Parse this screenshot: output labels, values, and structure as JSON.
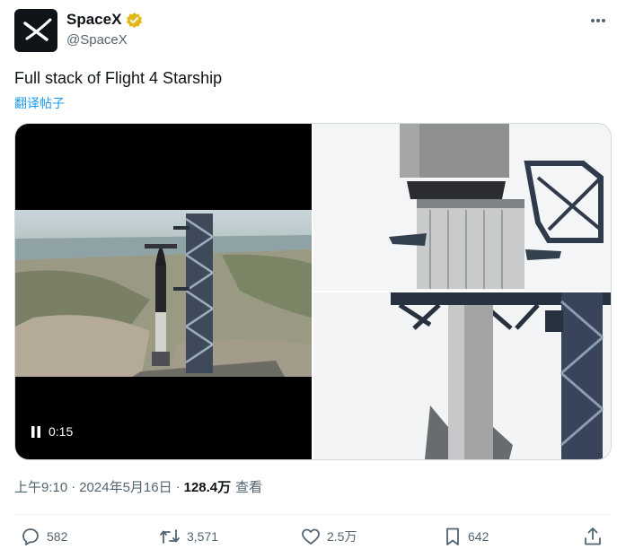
{
  "account": {
    "display_name": "SpaceX",
    "handle": "@SpaceX",
    "avatar_icon": "spacex-x-logo-icon",
    "verified_icon": "verified-badge-icon",
    "verified_color": "#e2b719"
  },
  "tweet": {
    "text": "Full stack of Flight 4 Starship",
    "translate_label": "翻译帖子",
    "accent_color": "#1d9bf0"
  },
  "media": {
    "video_time": "0:15",
    "pause_icon": "pause-icon"
  },
  "meta": {
    "time": "上午9:10",
    "separator": "·",
    "date": "2024年5月16日",
    "views": "128.4万",
    "views_label": "查看"
  },
  "actions": {
    "reply": {
      "icon": "reply-icon",
      "count": "582"
    },
    "retweet": {
      "icon": "retweet-icon",
      "count": "3,571"
    },
    "like": {
      "icon": "heart-icon",
      "count": "2.5万"
    },
    "bookmark": {
      "icon": "bookmark-icon",
      "count": "642"
    },
    "share": {
      "icon": "share-icon"
    }
  }
}
